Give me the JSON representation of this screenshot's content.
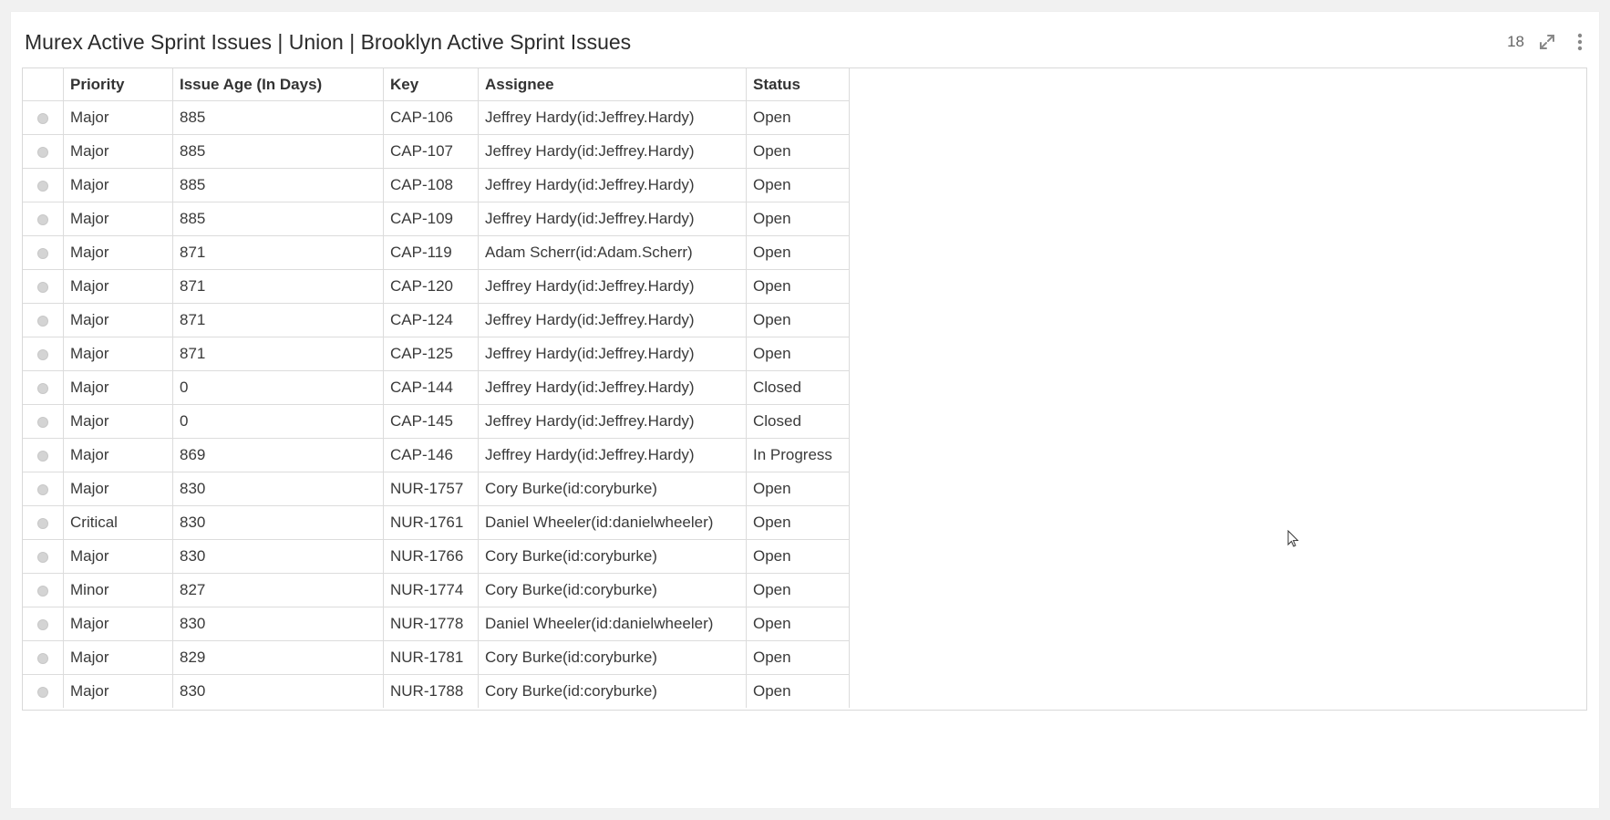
{
  "panel": {
    "title": "Murex Active Sprint Issues | Union | Brooklyn Active Sprint Issues",
    "count": "18",
    "icons": {
      "expand": "expand-icon",
      "menu": "kebab-menu-icon"
    }
  },
  "table": {
    "headers": {
      "priority": "Priority",
      "age": "Issue Age (In Days)",
      "key": "Key",
      "assignee": "Assignee",
      "status": "Status"
    },
    "rows": [
      {
        "priority": "Major",
        "age": "885",
        "key": "CAP-106",
        "assignee": "Jeffrey Hardy(id:Jeffrey.Hardy)",
        "status": "Open"
      },
      {
        "priority": "Major",
        "age": "885",
        "key": "CAP-107",
        "assignee": "Jeffrey Hardy(id:Jeffrey.Hardy)",
        "status": "Open"
      },
      {
        "priority": "Major",
        "age": "885",
        "key": "CAP-108",
        "assignee": "Jeffrey Hardy(id:Jeffrey.Hardy)",
        "status": "Open"
      },
      {
        "priority": "Major",
        "age": "885",
        "key": "CAP-109",
        "assignee": "Jeffrey Hardy(id:Jeffrey.Hardy)",
        "status": "Open"
      },
      {
        "priority": "Major",
        "age": "871",
        "key": "CAP-119",
        "assignee": "Adam Scherr(id:Adam.Scherr)",
        "status": "Open"
      },
      {
        "priority": "Major",
        "age": "871",
        "key": "CAP-120",
        "assignee": "Jeffrey Hardy(id:Jeffrey.Hardy)",
        "status": "Open"
      },
      {
        "priority": "Major",
        "age": "871",
        "key": "CAP-124",
        "assignee": "Jeffrey Hardy(id:Jeffrey.Hardy)",
        "status": "Open"
      },
      {
        "priority": "Major",
        "age": "871",
        "key": "CAP-125",
        "assignee": "Jeffrey Hardy(id:Jeffrey.Hardy)",
        "status": "Open"
      },
      {
        "priority": "Major",
        "age": "0",
        "key": "CAP-144",
        "assignee": "Jeffrey Hardy(id:Jeffrey.Hardy)",
        "status": "Closed"
      },
      {
        "priority": "Major",
        "age": "0",
        "key": "CAP-145",
        "assignee": "Jeffrey Hardy(id:Jeffrey.Hardy)",
        "status": "Closed"
      },
      {
        "priority": "Major",
        "age": "869",
        "key": "CAP-146",
        "assignee": "Jeffrey Hardy(id:Jeffrey.Hardy)",
        "status": "In Progress"
      },
      {
        "priority": "Major",
        "age": "830",
        "key": "NUR-1757",
        "assignee": "Cory Burke(id:coryburke)",
        "status": "Open"
      },
      {
        "priority": "Critical",
        "age": "830",
        "key": "NUR-1761",
        "assignee": "Daniel Wheeler(id:danielwheeler)",
        "status": "Open"
      },
      {
        "priority": "Major",
        "age": "830",
        "key": "NUR-1766",
        "assignee": "Cory Burke(id:coryburke)",
        "status": "Open"
      },
      {
        "priority": "Minor",
        "age": "827",
        "key": "NUR-1774",
        "assignee": "Cory Burke(id:coryburke)",
        "status": "Open"
      },
      {
        "priority": "Major",
        "age": "830",
        "key": "NUR-1778",
        "assignee": "Daniel Wheeler(id:danielwheeler)",
        "status": "Open"
      },
      {
        "priority": "Major",
        "age": "829",
        "key": "NUR-1781",
        "assignee": "Cory Burke(id:coryburke)",
        "status": "Open"
      },
      {
        "priority": "Major",
        "age": "830",
        "key": "NUR-1788",
        "assignee": "Cory Burke(id:coryburke)",
        "status": "Open"
      }
    ]
  }
}
